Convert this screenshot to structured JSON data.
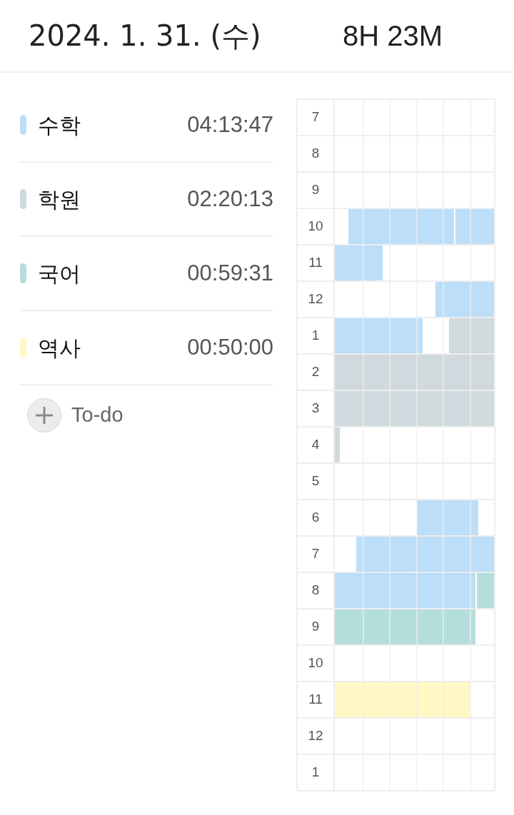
{
  "header": {
    "date": "2024. 1. 31. (수)",
    "total": "8H 23M"
  },
  "subjects": [
    {
      "name": "수학",
      "time": "04:13:47",
      "color": "#bcdef8"
    },
    {
      "name": "학원",
      "time": "02:20:13",
      "color": "#d0d9de"
    },
    {
      "name": "국어",
      "time": "00:59:31",
      "color": "#b3dedb"
    },
    {
      "name": "역사",
      "time": "00:50:00",
      "color": "#fff8c4"
    }
  ],
  "todo_button": {
    "label": "To-do"
  },
  "timetable": {
    "hours": [
      "7",
      "8",
      "9",
      "10",
      "11",
      "12",
      "1",
      "2",
      "3",
      "4",
      "5",
      "6",
      "7",
      "8",
      "9",
      "10",
      "11",
      "12",
      "1"
    ]
  }
}
